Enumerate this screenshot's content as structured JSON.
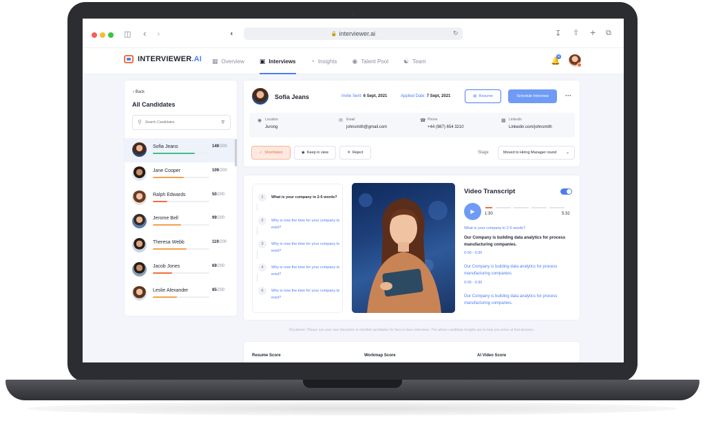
{
  "browser": {
    "url": "interviewer.ai"
  },
  "app": {
    "logo_main": "INTERVIEWER",
    "logo_suffix": ".AI",
    "nav": [
      {
        "label": "Overview",
        "icon": "grid-icon"
      },
      {
        "label": "Interviews",
        "icon": "monitor-icon",
        "active": true
      },
      {
        "label": "Insights",
        "icon": "chart-icon"
      },
      {
        "label": "Talent Pool",
        "icon": "users-circle-icon"
      },
      {
        "label": "Team",
        "icon": "team-icon"
      }
    ],
    "notification_count": "4"
  },
  "sidebar": {
    "back_label": "Back",
    "title": "All Candidates",
    "search_placeholder": "Search Candidates",
    "candidates": [
      {
        "name": "Sofia Jeans",
        "score": "149",
        "denom": "/200",
        "progress": 0.745,
        "color": "#3fbf7f",
        "active": true
      },
      {
        "name": "Jane Cooper",
        "score": "109",
        "denom": "/200",
        "progress": 0.545,
        "color": "#f5a04a"
      },
      {
        "name": "Ralph Edwards",
        "score": "50",
        "denom": "/200",
        "progress": 0.25,
        "color": "#f26d3d"
      },
      {
        "name": "Jerome Bell",
        "score": "99",
        "denom": "/200",
        "progress": 0.495,
        "color": "#f5a04a"
      },
      {
        "name": "Theresa Webb",
        "score": "119",
        "denom": "/200",
        "progress": 0.595,
        "color": "#f5a04a"
      },
      {
        "name": "Jacob Jones",
        "score": "69",
        "denom": "/200",
        "progress": 0.345,
        "color": "#f26d3d"
      },
      {
        "name": "Leslie Alexander",
        "score": "85",
        "denom": "/200",
        "progress": 0.425,
        "color": "#f5a04a"
      }
    ]
  },
  "profile": {
    "name": "Sofia Jeans",
    "invite_label": "Invite Sent:",
    "invite_date": "6 Sept, 2021",
    "applied_label": "Applied Date:",
    "applied_date": "7 Sept, 2021",
    "resume_label": "Resume",
    "schedule_label": "Schedule Interview",
    "location_label": "Location",
    "location_value": "Jurong",
    "email_label": "Email",
    "email_value": "johnsmith@gmail.com",
    "phone_label": "Phone",
    "phone_value": "+44 (987) 654 3210",
    "linkedin_label": "Linkedin",
    "linkedin_value": "Linkedin.com/johnsmith",
    "shortlisted_label": "Shortlisted",
    "keep_label": "Keep in view",
    "reject_label": "Reject",
    "stage_label": "Stage",
    "stage_value": "Moved to Hiring Manager round"
  },
  "questions": [
    {
      "num": "1",
      "text": "What is your company in 2-5 words?"
    },
    {
      "num": "2",
      "text": "Why is now the time for your company to exist?"
    },
    {
      "num": "3",
      "text": "Why is now the time for your company to exist?"
    },
    {
      "num": "4",
      "text": "Why is now the time for your company to exist?"
    },
    {
      "num": "6",
      "text": "Why is now the time for your company to exist?"
    }
  ],
  "transcript": {
    "title": "Video Transcript",
    "current": "1:30",
    "duration": "5:32",
    "question": "What is your company in 2-5 words?",
    "p1": "Our Company is building data analytics for process manufacturing companies.",
    "t1": "0:00 - 0:30",
    "p2": "Our Company is building data analytics for process manufacturing companies.",
    "t2": "0:00 - 0:30",
    "p3": "Our Company is building data analytics for process manufacturing companies."
  },
  "disclaimer": "Disclaimer: Please use your own discretion to shortlist candidates for face-to-face interviews. The above candidate insights are to help you arrive at that decision.",
  "scores": {
    "resume": "Resume Score",
    "workmap": "Workmap Score",
    "ai_video": "AI Video Score"
  }
}
